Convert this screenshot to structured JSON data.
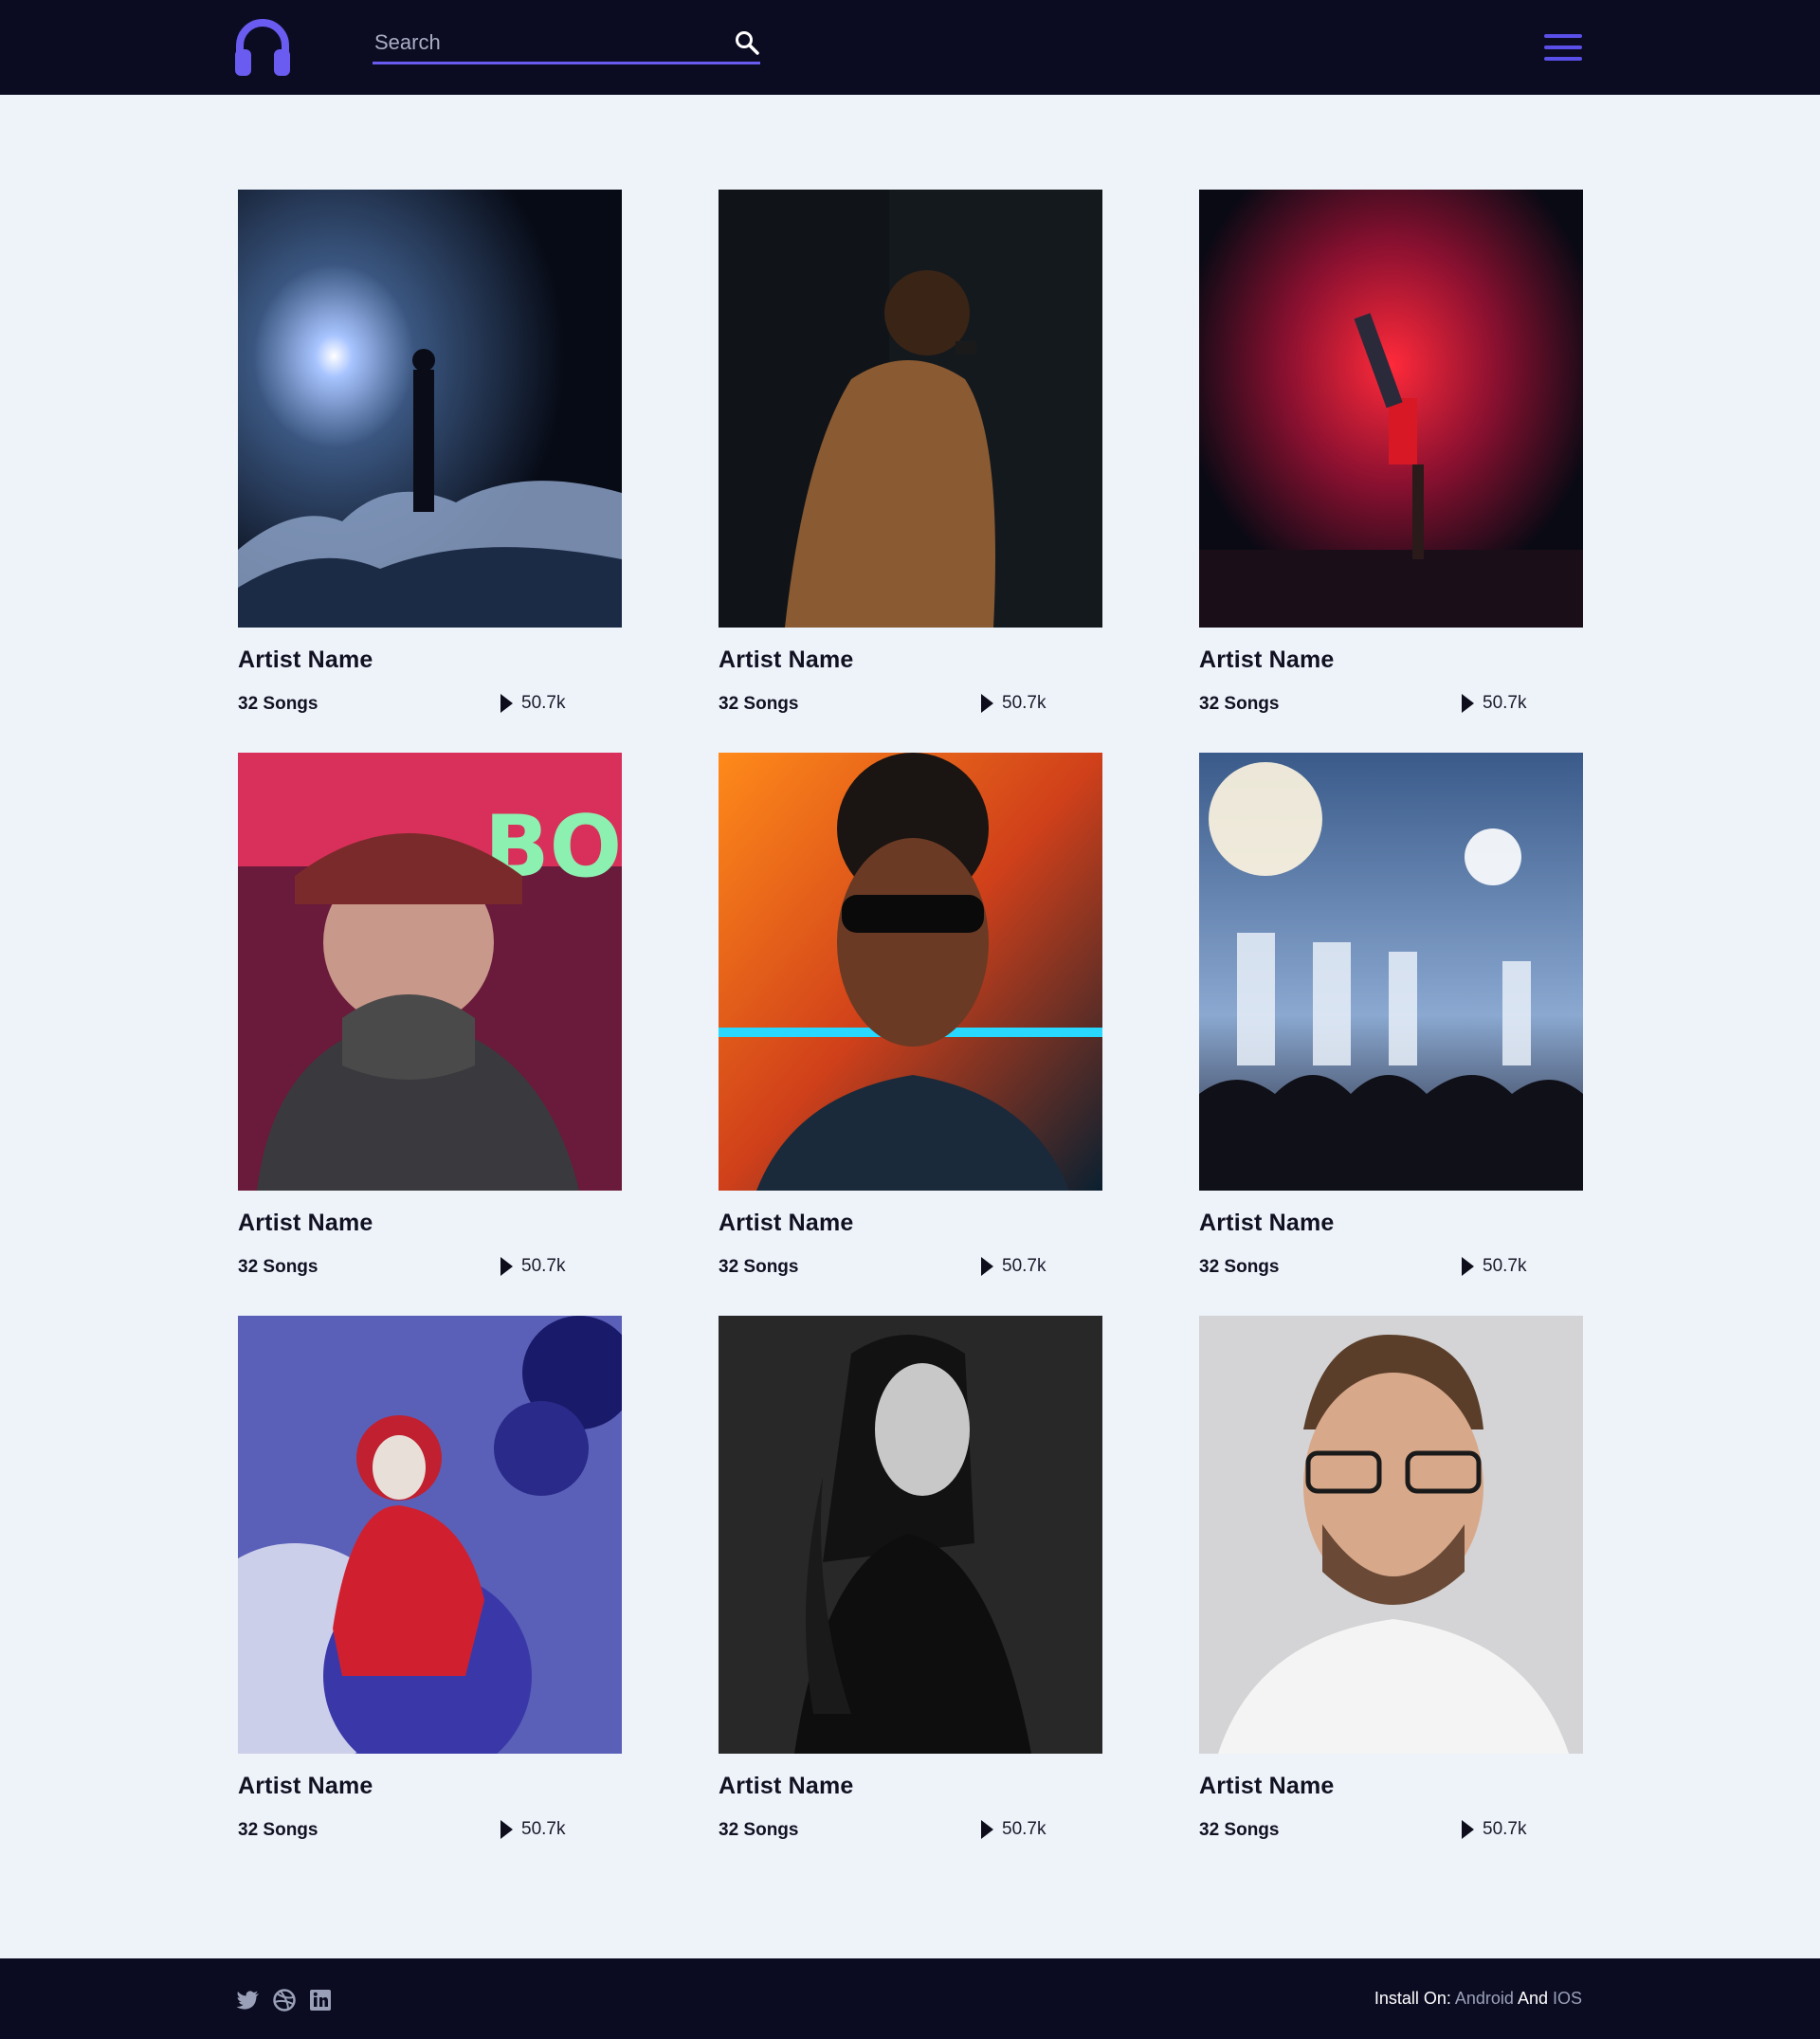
{
  "header": {
    "logo_icon": "headphones-icon",
    "search": {
      "placeholder": "Search",
      "value": "",
      "icon": "search-icon"
    },
    "menu_icon": "hamburger-menu-icon",
    "accent_color": "#6a5cf0"
  },
  "artists": [
    {
      "name": "Artist Name",
      "songs": "32 Songs",
      "plays": "50.7k"
    },
    {
      "name": "Artist Name",
      "songs": "32 Songs",
      "plays": "50.7k"
    },
    {
      "name": "Artist Name",
      "songs": "32 Songs",
      "plays": "50.7k"
    },
    {
      "name": "Artist Name",
      "songs": "32 Songs",
      "plays": "50.7k"
    },
    {
      "name": "Artist Name",
      "songs": "32 Songs",
      "plays": "50.7k"
    },
    {
      "name": "Artist Name",
      "songs": "32 Songs",
      "plays": "50.7k"
    },
    {
      "name": "Artist Name",
      "songs": "32 Songs",
      "plays": "50.7k"
    },
    {
      "name": "Artist Name",
      "songs": "32 Songs",
      "plays": "50.7k"
    },
    {
      "name": "Artist Name",
      "songs": "32 Songs",
      "plays": "50.7k"
    }
  ],
  "footer": {
    "social_icons": [
      "twitter-icon",
      "dribbble-icon",
      "linkedin-icon"
    ],
    "install_label": "Install On:",
    "android_label": "Android",
    "and_label": "And",
    "ios_label": "IOS"
  }
}
